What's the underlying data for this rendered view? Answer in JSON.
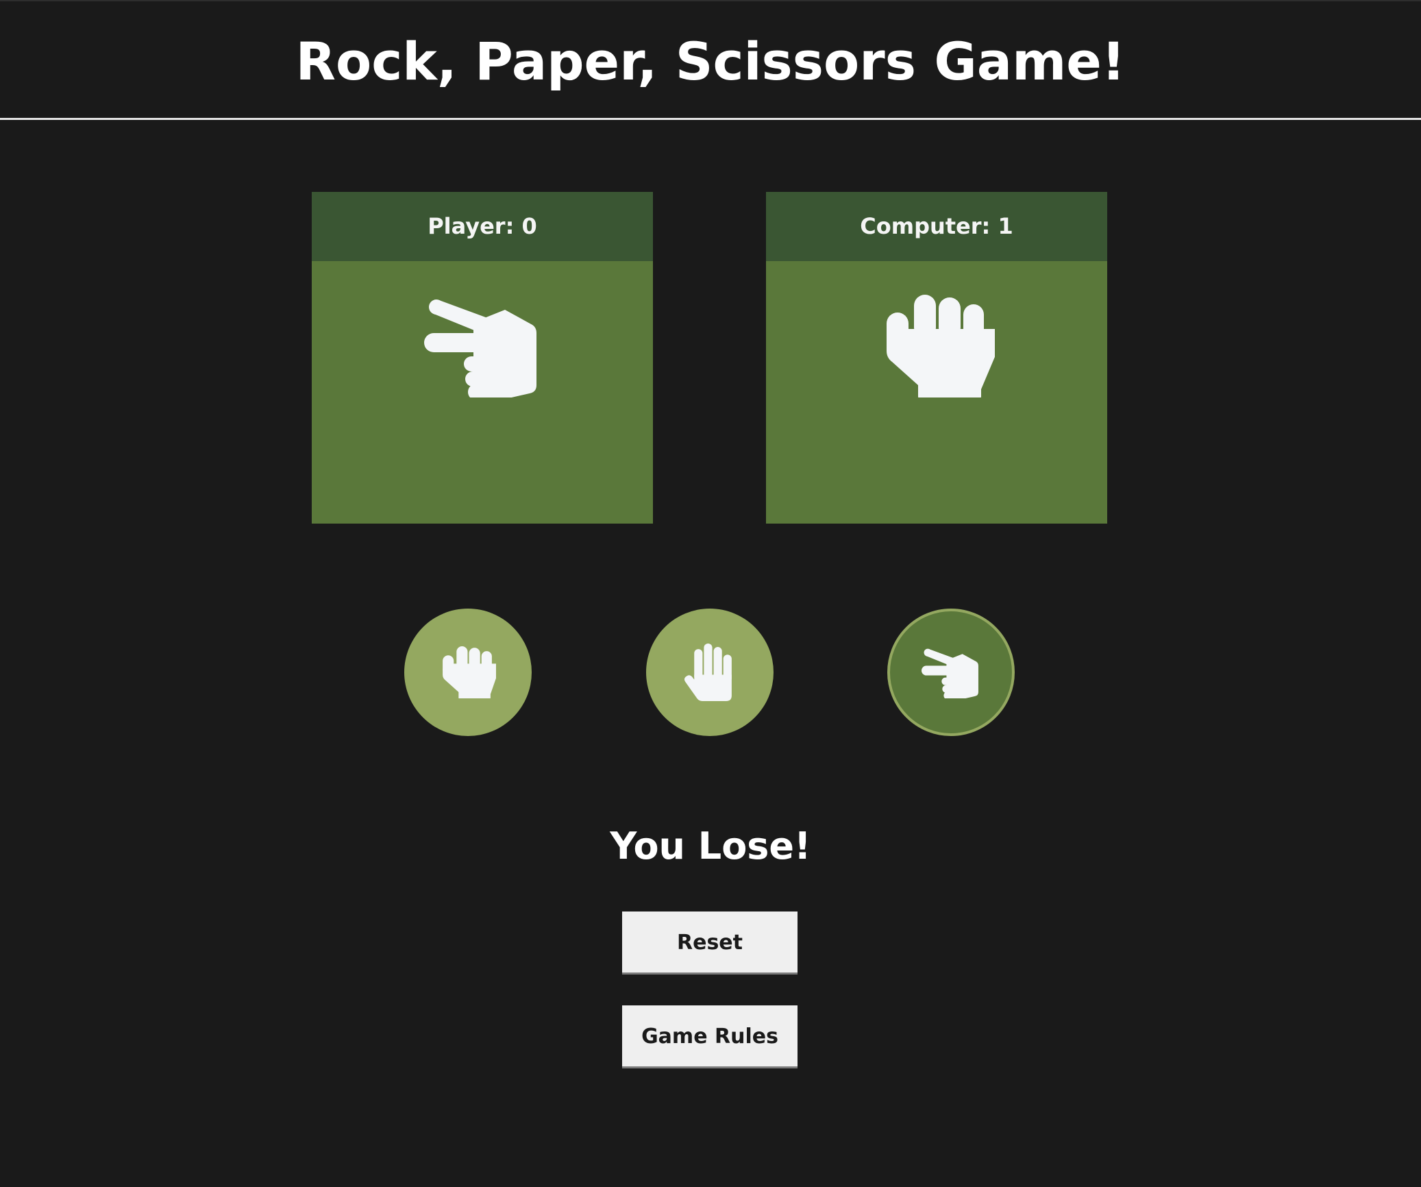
{
  "header": {
    "title": "Rock, Paper, Scissors Game!"
  },
  "scoreboard": {
    "player": {
      "label": "Player: 0",
      "hand_icon": "scissors-hand-icon"
    },
    "computer": {
      "label": "Computer: 1",
      "hand_icon": "rock-fist-icon"
    }
  },
  "choices": [
    {
      "name": "rock",
      "icon": "rock-fist-icon",
      "selected": false
    },
    {
      "name": "paper",
      "icon": "paper-hand-icon",
      "selected": false
    },
    {
      "name": "scissors",
      "icon": "scissors-hand-icon",
      "selected": true
    }
  ],
  "result": {
    "message": "You Lose!"
  },
  "buttons": {
    "reset_label": "Reset",
    "rules_label": "Game Rules"
  },
  "colors": {
    "background": "#1a1a1a",
    "card": "#5a783a",
    "card_header": "#3a5633",
    "choice": "#94a860",
    "button": "#efefef"
  }
}
